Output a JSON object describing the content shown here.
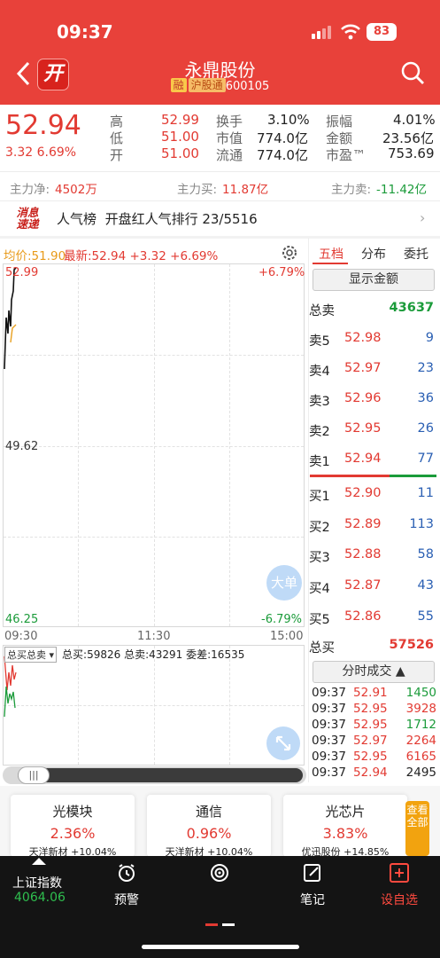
{
  "status": {
    "time": "09:37",
    "battery": "83"
  },
  "header": {
    "name": "永鼎股份",
    "tag_margin": "融",
    "tag_connect": "沪股通",
    "code": "600105",
    "logo": "开"
  },
  "quote": {
    "price": "52.94",
    "change": "3.32 6.69%",
    "high_label": "高",
    "high": "52.99",
    "low_label": "低",
    "low": "51.00",
    "open_label": "开",
    "open": "51.00",
    "turnover_label": "换手",
    "turnover": "3.10%",
    "mktcap_label": "市值",
    "mktcap": "774.0亿",
    "float_label": "流通",
    "float": "774.0亿",
    "amplitude_label": "振幅",
    "amplitude": "4.01%",
    "amount_label": "金额",
    "amount": "23.56亿",
    "pe_label": "市盈™",
    "pe": "753.69"
  },
  "flow": {
    "net_label": "主力净:",
    "net": "4502万",
    "buy_label": "主力买:",
    "buy": "11.87亿",
    "sell_label": "主力卖:",
    "sell": "-11.42亿"
  },
  "news": {
    "logo_top": "消息",
    "logo_bottom": "速递",
    "title": "人气榜",
    "text": "开盘红人气排行 23/5516"
  },
  "chart": {
    "avg_label": "均价:51.90",
    "latest_label": "最新:52.94 +3.32 +6.69%",
    "y_top": "52.99",
    "y_mid": "49.62",
    "y_bot": "46.25",
    "pct_top": "+6.79%",
    "pct_bot": "-6.79%",
    "t_start": "09:30",
    "t_mid": "11:30",
    "t_end": "15:00",
    "big_order": "大单",
    "vol_select": "总买总卖 ▾",
    "vol_buy": "总买:59826",
    "vol_sell": "总卖:43291",
    "vol_diff": "委差:16535"
  },
  "book": {
    "tabs": [
      "五档",
      "分布",
      "委托"
    ],
    "show_amount": "显示金额",
    "total_sell_label": "总卖",
    "total_sell": "43637",
    "asks": [
      {
        "k": "卖5",
        "p": "52.98",
        "v": "9"
      },
      {
        "k": "卖4",
        "p": "52.97",
        "v": "23"
      },
      {
        "k": "卖3",
        "p": "52.96",
        "v": "36"
      },
      {
        "k": "卖2",
        "p": "52.95",
        "v": "26"
      },
      {
        "k": "卖1",
        "p": "52.94",
        "v": "77"
      }
    ],
    "bids": [
      {
        "k": "买1",
        "p": "52.90",
        "v": "11"
      },
      {
        "k": "买2",
        "p": "52.89",
        "v": "113"
      },
      {
        "k": "买3",
        "p": "52.88",
        "v": "58"
      },
      {
        "k": "买4",
        "p": "52.87",
        "v": "43"
      },
      {
        "k": "买5",
        "p": "52.86",
        "v": "55"
      }
    ],
    "total_buy_label": "总买",
    "total_buy": "57526",
    "trades_head": "分时成交 ▲",
    "trades": [
      {
        "t": "09:37",
        "p": "52.91",
        "v": "1450"
      },
      {
        "t": "09:37",
        "p": "52.95",
        "v": "3928"
      },
      {
        "t": "09:37",
        "p": "52.95",
        "v": "1712"
      },
      {
        "t": "09:37",
        "p": "52.97",
        "v": "2264"
      },
      {
        "t": "09:37",
        "p": "52.95",
        "v": "6165"
      },
      {
        "t": "09:37",
        "p": "52.94",
        "v": "2495"
      }
    ]
  },
  "sectors": [
    {
      "name": "光模块",
      "chg": "2.36%",
      "sub": "天洋新材 +10.04%"
    },
    {
      "name": "通信",
      "chg": "0.96%",
      "sub": "天洋新材 +10.04%"
    },
    {
      "name": "光芯片",
      "chg": "3.83%",
      "sub": "优迅股份 +14.85%"
    }
  ],
  "view_all": "查看全部",
  "nav": {
    "index_name": "上证指数",
    "index_value": "4064.06",
    "alert": "预警",
    "notes": "笔记",
    "watch": "设自选"
  },
  "colors": {
    "brand": "#e8413a",
    "up": "#e23a32",
    "down": "#1b9b3a",
    "volume": "#2a5fb3"
  }
}
